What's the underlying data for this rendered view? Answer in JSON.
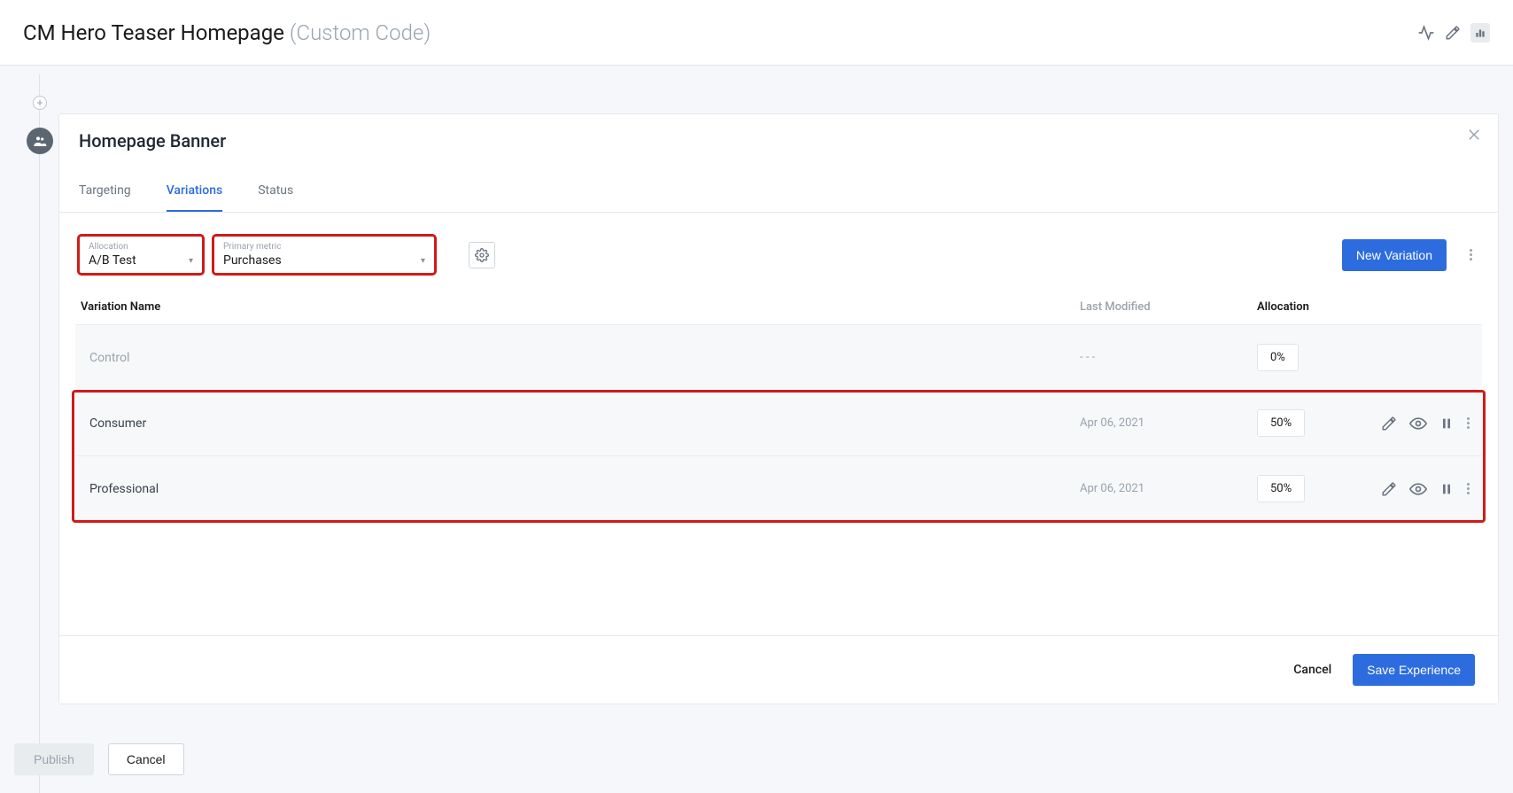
{
  "header": {
    "title_main": "CM Hero Teaser Homepage",
    "title_sub": "(Custom Code)"
  },
  "timeline": {
    "plus_label": "+"
  },
  "panel": {
    "title": "Homepage Banner",
    "allocation_label": "Allocation",
    "allocation_value": "A/B Test",
    "metric_label": "Primary metric",
    "metric_value": "Purchases",
    "new_variation": "New Variation"
  },
  "tabs": [
    {
      "label": "Targeting",
      "active": false
    },
    {
      "label": "Variations",
      "active": true
    },
    {
      "label": "Status",
      "active": false
    }
  ],
  "columns": {
    "name": "Variation Name",
    "modified": "Last Modified",
    "allocation": "Allocation"
  },
  "rows": [
    {
      "name": "Control",
      "modified": "- - -",
      "allocation": "0%",
      "muted": true,
      "actions": false
    },
    {
      "name": "Consumer",
      "modified": "Apr 06, 2021",
      "allocation": "50%",
      "muted": false,
      "actions": true
    },
    {
      "name": "Professional",
      "modified": "Apr 06, 2021",
      "allocation": "50%",
      "muted": false,
      "actions": true
    }
  ],
  "footer": {
    "cancel": "Cancel",
    "save": "Save Experience"
  },
  "page_footer": {
    "publish": "Publish",
    "cancel": "Cancel"
  }
}
